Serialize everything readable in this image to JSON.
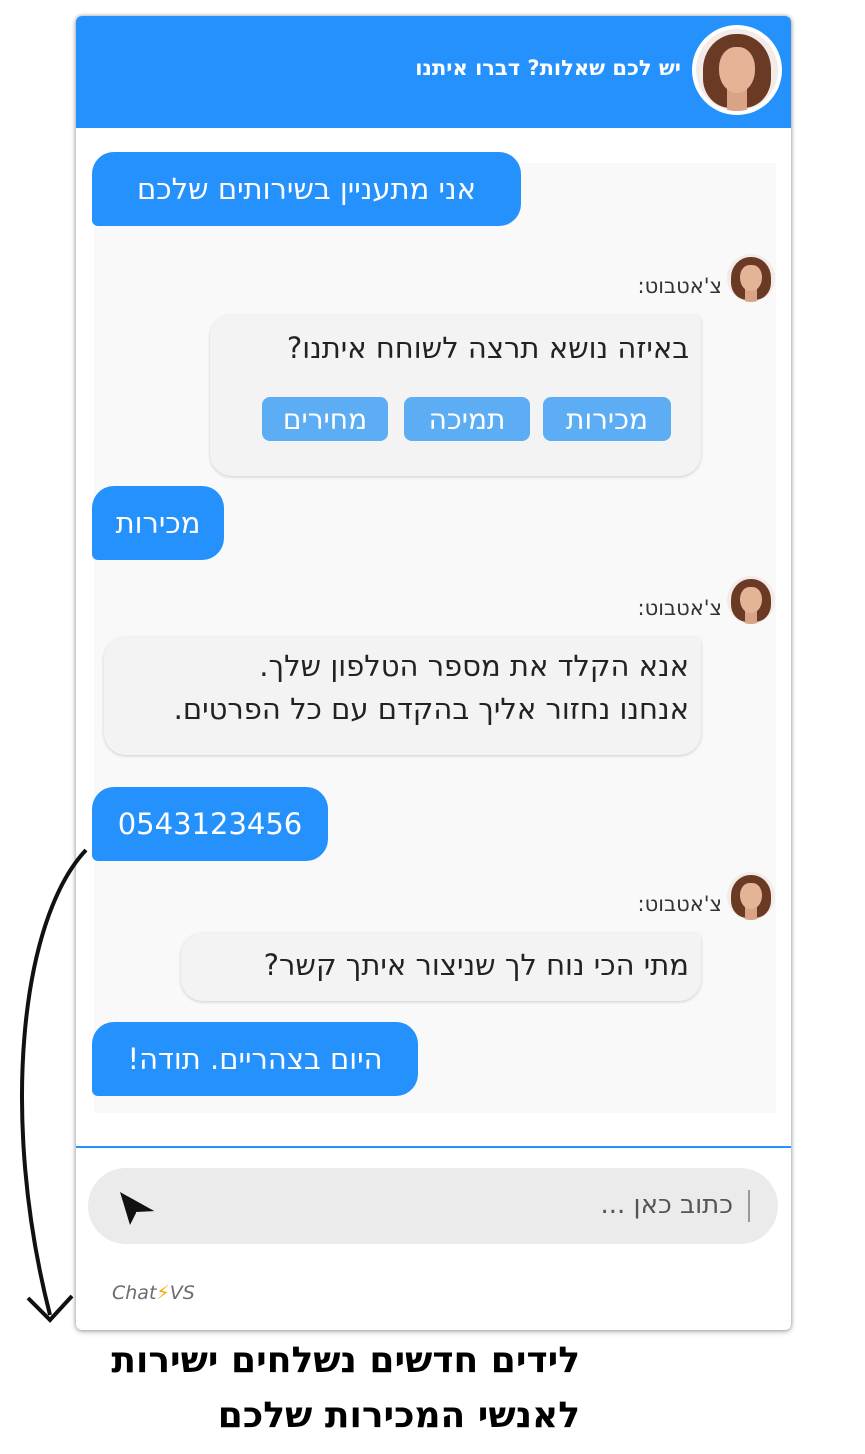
{
  "header": {
    "title": "יש לכם שאלות? דברו איתנו"
  },
  "messages": {
    "m1_user": "אני מתעניין בשירותים שלכם",
    "bot_name": "צ'אטבוט:",
    "m2_bot": "באיזה נושא תרצה לשוחח איתנו?",
    "chips": [
      "מכירות",
      "תמיכה",
      "מחירים"
    ],
    "m3_user": "מכירות",
    "m4_bot_line1": "אנא הקלד את מספר הטלפון שלך.",
    "m4_bot_line2": "אנחנו נחזור אליך בהקדם עם כל הפרטים.",
    "m5_user": "0543123456",
    "m6_bot": "מתי הכי נוח לך שניצור איתך קשר?",
    "m7_user": "היום בצהריים. תודה!"
  },
  "input": {
    "placeholder": "כתוב כאן ..."
  },
  "brand": {
    "prefix": "Chat",
    "suffix": "VS"
  },
  "caption": {
    "line1": "לידים חדשים נשלחים ישירות",
    "line2": "לאנשי המכירות שלכם"
  },
  "colors": {
    "accent": "#2591fd",
    "chip": "#5cadf4",
    "bot_bubble": "#f3f3f3"
  }
}
